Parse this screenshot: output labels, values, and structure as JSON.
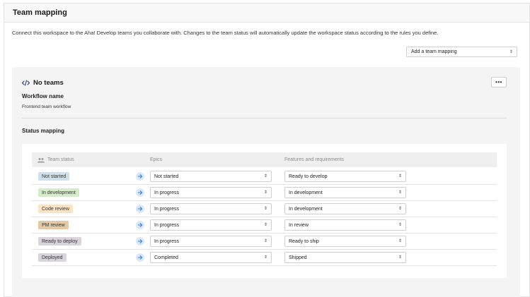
{
  "header": {
    "title": "Team mapping"
  },
  "description": "Connect this workspace to the Aha! Develop teams you collaborate with. Changes to the team status will automatically update the workspace status according to the rules you define.",
  "add_mapping": {
    "label": "Add a team mapping"
  },
  "card": {
    "title": "No teams",
    "workflow_label": "Workflow name",
    "workflow_value": "Frontend team workflow",
    "more_label": "•••",
    "status_heading": "Status mapping"
  },
  "table": {
    "columns": [
      "Team status",
      "Epics",
      "Features and requirements"
    ],
    "rows": [
      {
        "status": "Not started",
        "badge_color": "#cfe0ea",
        "epic": "Not started",
        "feature": "Ready to develop"
      },
      {
        "status": "In development",
        "badge_color": "#d5ebc9",
        "epic": "In progress",
        "feature": "In development"
      },
      {
        "status": "Code review",
        "badge_color": "#fbe3c6",
        "epic": "In progress",
        "feature": "In development"
      },
      {
        "status": "PM review",
        "badge_color": "#e3c9a5",
        "epic": "In progress",
        "feature": "In review"
      },
      {
        "status": "Ready to deploy",
        "badge_color": "#d9d3dc",
        "epic": "In progress",
        "feature": "Ready to ship"
      },
      {
        "status": "Deployed",
        "badge_color": "#d9d3dc",
        "epic": "Completed",
        "feature": "Shipped"
      }
    ]
  },
  "colors": {
    "arrow_bg": "#dbe8f8",
    "arrow": "#3b82d6",
    "card_bg": "#f4f4f4"
  },
  "icons": {
    "title": "code-icon",
    "header": "users-icon",
    "row": "arrow-right-icon",
    "select": "select-chevron-icon"
  }
}
